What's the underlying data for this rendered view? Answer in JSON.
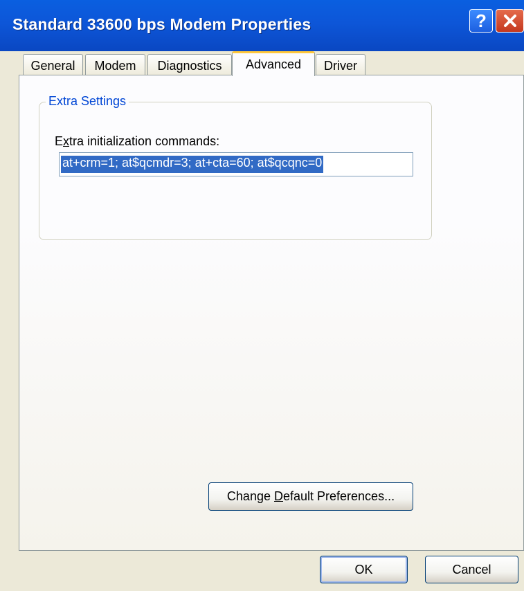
{
  "window": {
    "title": "Standard 33600 bps Modem Properties",
    "help_glyph": "?",
    "accent": "#0a5fe0"
  },
  "tabs": [
    {
      "label": "General"
    },
    {
      "label": "Modem"
    },
    {
      "label": "Diagnostics"
    },
    {
      "label": "Advanced",
      "active": true
    },
    {
      "label": "Driver"
    }
  ],
  "advanced": {
    "group_title": "Extra Settings",
    "field_label_pre": "E",
    "field_label_mn": "x",
    "field_label_post": "tra initialization commands:",
    "init_commands": "at+crm=1; at$qcmdr=3; at+cta=60; at$qcqnc=0",
    "change_pre": "Change ",
    "change_mn": "D",
    "change_post": "efault Preferences..."
  },
  "footer": {
    "ok_label": "OK",
    "cancel_label": "Cancel"
  }
}
